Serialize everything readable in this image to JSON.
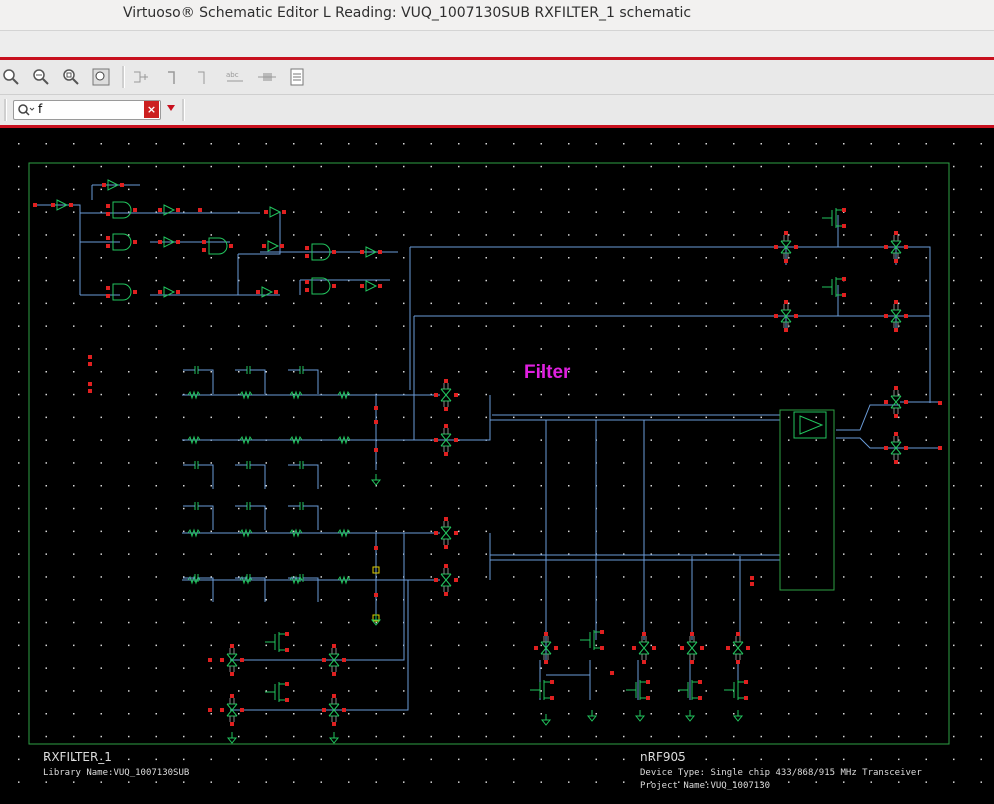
{
  "window": {
    "title": "Virtuoso® Schematic Editor L Reading: VUQ_1007130SUB RXFILTER_1 schematic"
  },
  "toolbar": {
    "icons": [
      "zoom-fit-icon",
      "zoom-in-icon",
      "zoom-out-icon",
      "zoom-area-icon",
      "add-pin-icon",
      "add-wire-icon",
      "add-wire-narrow-icon",
      "add-label-icon",
      "add-instance-icon",
      "properties-icon"
    ]
  },
  "search": {
    "value": "f",
    "clear_label": "×"
  },
  "schematic": {
    "net_label": "Filter",
    "colors": {
      "wire": "#6a9bd8",
      "symbol": "#22c55e",
      "pin": "#e02020",
      "frame": "#2ea043",
      "label": "#e020e0"
    }
  },
  "titleblock": {
    "cell_name": "RXFILTER_1",
    "library": "Library Name:VUQ_1007130SUB",
    "device_name": "nRF905",
    "device_type": "Device Type: Single chip 433/868/915 MHz Transceiver",
    "project": "Project Name:VUQ_1007130"
  }
}
